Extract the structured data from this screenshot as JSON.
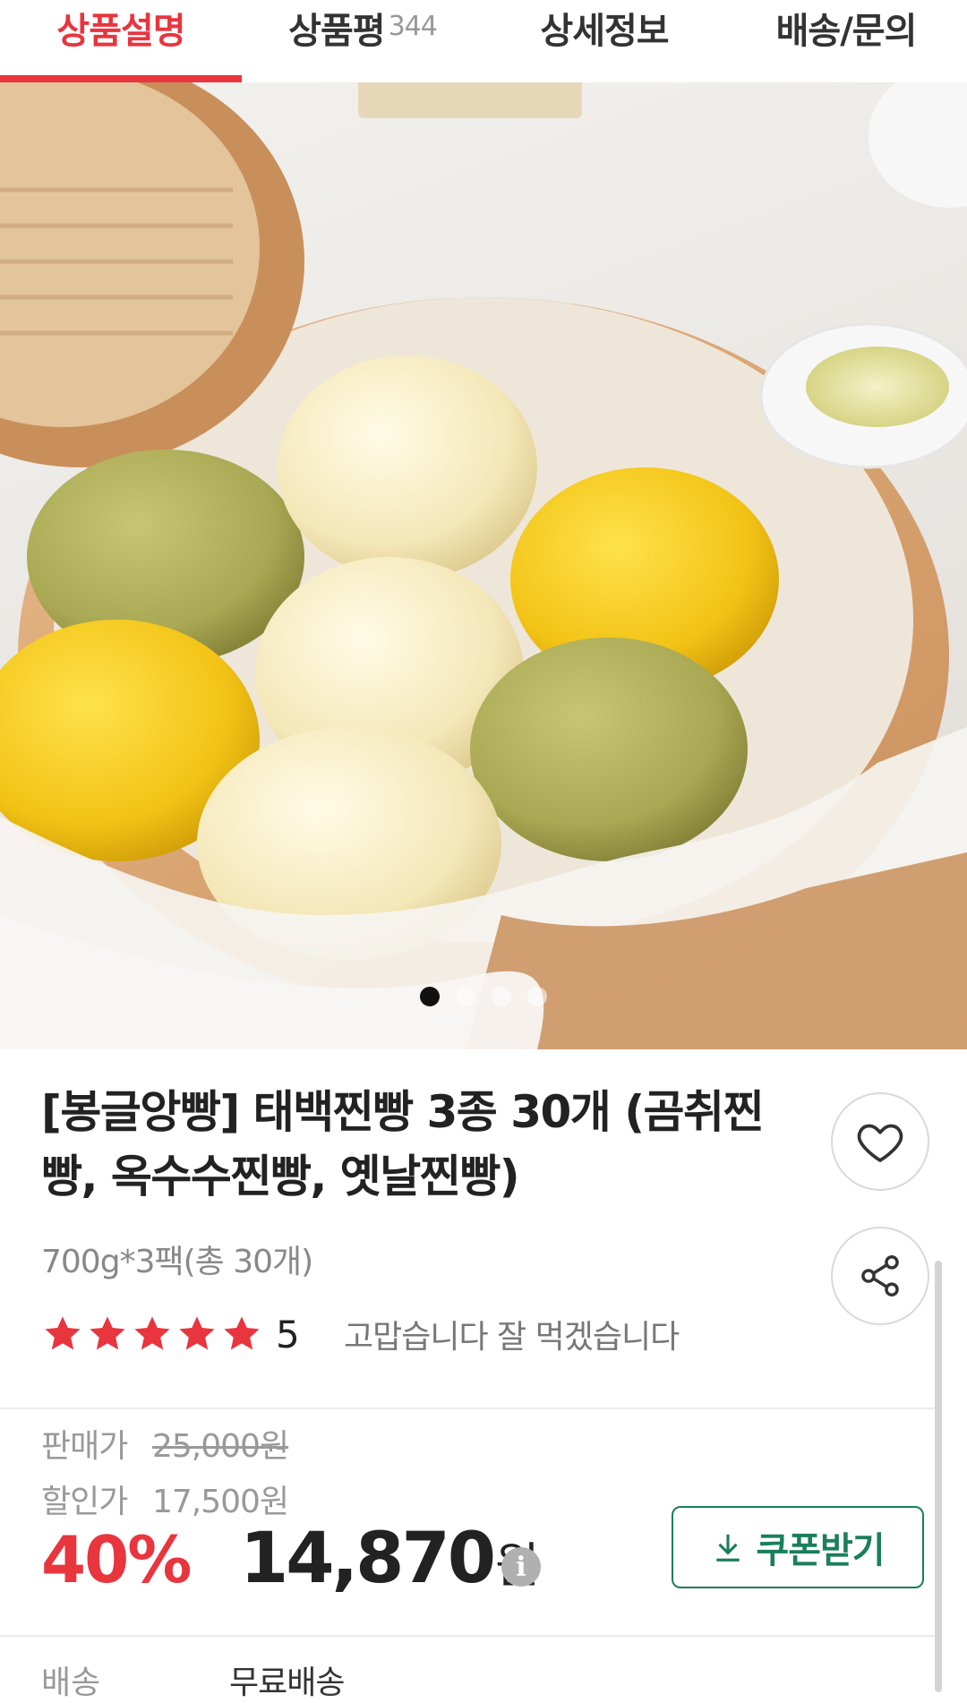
{
  "tabs": [
    {
      "label": "상품설명",
      "active": true
    },
    {
      "label": "상품평",
      "count": "344",
      "active": false
    },
    {
      "label": "상세정보",
      "active": false
    },
    {
      "label": "배송/문의",
      "active": false
    }
  ],
  "hero": {
    "image": "steamed-buns-in-bamboo-steamer",
    "carousel_dots": 4,
    "active_dot": 1
  },
  "product": {
    "title": "[봉글앙빵] 태백찐빵 3종 30개 (곰취찐빵, 옥수수찐빵, 옛날찐빵)",
    "subtitle": "700g*3팩(총 30개)",
    "rating_stars": 5,
    "rating_score": "5",
    "review_snippet": "고맙습니다 잘 먹겠습니다"
  },
  "pricing": {
    "sale_label": "판매가",
    "sale_price": "25,000원",
    "discount_label": "할인가",
    "discount_price": "17,500원",
    "discount_rate": "40%",
    "final_amount": "14,870",
    "final_unit": "원",
    "coupon_label": "쿠폰받기"
  },
  "shipping": {
    "label": "배송",
    "value": "무료배송"
  },
  "colors": {
    "accent": "#e8353e",
    "coupon": "#1a7f5a",
    "star": "#e8353e"
  }
}
